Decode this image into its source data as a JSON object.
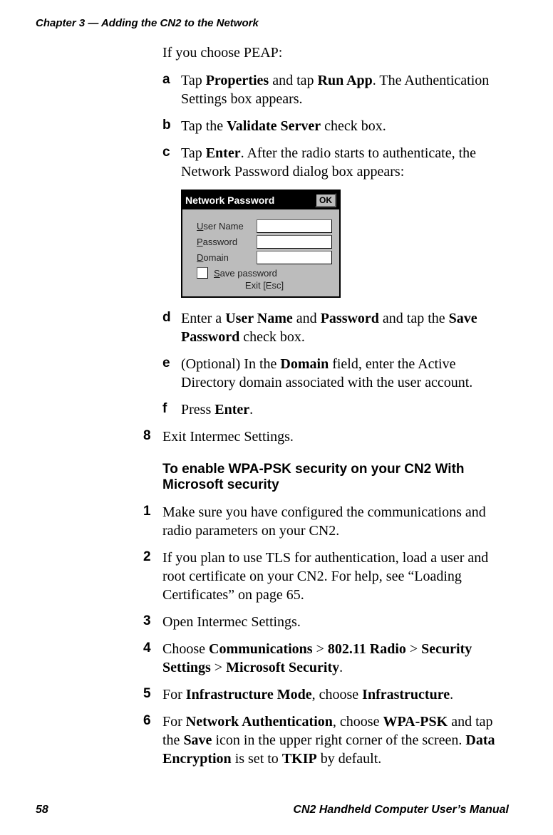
{
  "chapter_header": "Chapter 3 — Adding the CN2 to the Network",
  "peap_intro": "If you choose PEAP:",
  "a_marker": "a",
  "a_text": "Tap Properties and tap Run App. The Authentication Settings box appears.",
  "b_marker": "b",
  "b_text": "Tap the Validate Server check box.",
  "c_marker": "c",
  "c_text": "Tap Enter. After the radio starts to authenticate, the Network Password dialog box appears:",
  "dialog": {
    "title": "Network Password",
    "ok": "OK",
    "user_name": "User Name",
    "password": "Password",
    "domain": "Domain",
    "save_password": "Save password",
    "exit": "Exit [Esc]"
  },
  "d_marker": "d",
  "d_text": "Enter a User Name and Password and tap the Save Password check box.",
  "e_marker": "e",
  "e_text": "(Optional) In the Domain field, enter the Active Directory domain associated with the user account.",
  "f_marker": "f",
  "f_text": "Press Enter.",
  "n8_marker": "8",
  "n8_text": "Exit Intermec Settings.",
  "section_title": "To enable WPA-PSK security on your CN2 With Microsoft security",
  "n1_marker": "1",
  "n1_text": "Make sure you have configured the communications and radio parameters on your CN2.",
  "n2_marker": "2",
  "n2_text": "If you plan to use TLS for authentication, load a user and root certificate on your CN2. For help, see “Loading Certificates” on page 65.",
  "n3_marker": "3",
  "n3_text": "Open Intermec Settings.",
  "n4_marker": "4",
  "n4_text": "Choose Communications > 802.11 Radio > Security Settings > Microsoft Security.",
  "n5_marker": "5",
  "n5_text": "For Infrastructure Mode, choose Infrastructure.",
  "n6_marker": "6",
  "n6_text": "For Network Authentication, choose WPA-PSK and tap the Save icon in the upper right corner of the screen. Data Encryption is set to TKIP by default.",
  "footer_page": "58",
  "footer_manual": "CN2 Handheld Computer User’s Manual"
}
